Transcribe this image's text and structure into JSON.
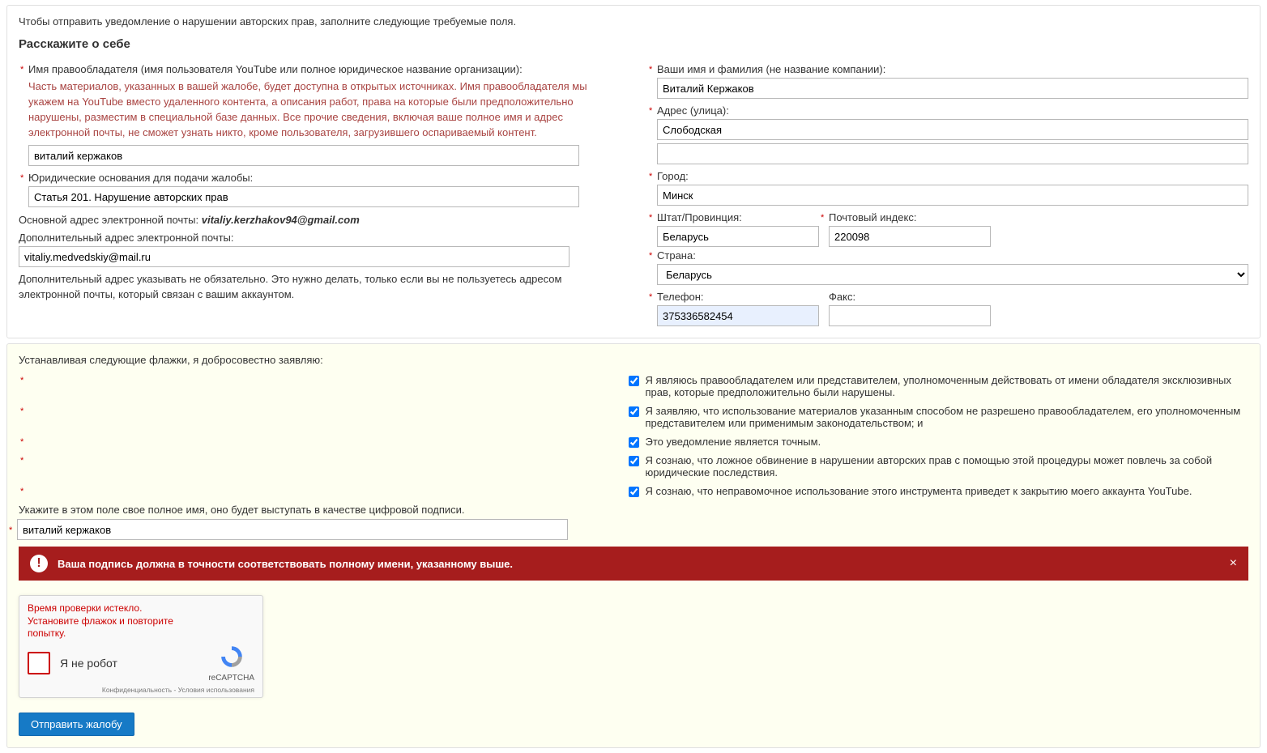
{
  "intro": "Чтобы отправить уведомление о нарушении авторских прав, заполните следующие требуемые поля.",
  "about_heading": "Расскажите о себе",
  "left": {
    "owner_name_label": "Имя правообладателя (имя пользователя YouTube или полное юридическое название организации):",
    "owner_warning": "Часть материалов, указанных в вашей жалобе, будет доступна в открытых источниках. Имя правообладателя мы укажем на YouTube вместо удаленного контента, а описания работ, права на которые были предположительно нарушены, разместим в специальной базе данных. Все прочие сведения, включая ваше полное имя и адрес электронной почты, не сможет узнать никто, кроме пользователя, загрузившего оспариваемый контент.",
    "owner_value": "виталий кержаков",
    "legal_label": "Юридические основания для подачи жалобы:",
    "legal_value": "Статья 201. Нарушение авторских прав",
    "primary_email_label": "Основной адрес электронной почты: ",
    "primary_email_value": "vitaliy.kerzhakov94@gmail.com",
    "alt_email_label": "Дополнительный адрес электронной почты:",
    "alt_email_value": "vitaliy.medvedskiy@mail.ru",
    "alt_help": "Дополнительный адрес указывать не обязательно. Это нужно делать, только если вы не пользуетесь адресом электронной почты, который связан с вашим аккаунтом."
  },
  "right": {
    "fullname_label": "Ваши имя и фамилия (не название компании):",
    "fullname_value": "Виталий Кержаков",
    "street_label": "Адрес (улица):",
    "street_value": "Слободская",
    "street2_value": "",
    "city_label": "Город:",
    "city_value": "Минск",
    "state_label": "Штат/Провинция:",
    "state_value": "Беларусь",
    "zip_label": "Почтовый индекс:",
    "zip_value": "220098",
    "country_label": "Страна:",
    "country_value": "Беларусь",
    "phone_label": "Телефон:",
    "phone_value": "375336582454",
    "fax_label": "Факс:",
    "fax_value": ""
  },
  "decl": {
    "intro": "Устанавливая следующие флажки, я добросовестно заявляю:",
    "c1": "Я являюсь правообладателем или представителем, уполномоченным действовать от имени обладателя эксклюзивных прав, которые предположительно были нарушены.",
    "c2": "Я заявляю, что использование материалов указанным способом не разрешено правообладателем, его уполномоченным представителем или применимым законодательством; и",
    "c3": "Это уведомление является точным.",
    "c4": "Я сознаю, что ложное обвинение в нарушении авторских прав с помощью этой процедуры может повлечь за собой юридические последствия.",
    "c5": "Я сознаю, что неправомочное использование этого инструмента приведет к закрытию моего аккаунта YouTube.",
    "sig_label": "Укажите в этом поле свое полное имя, оно будет выступать в качестве цифровой подписи.",
    "sig_value": "виталий кержаков"
  },
  "alert": "Ваша подпись должна в точности соответствовать полному имени, указанному выше.",
  "recaptcha": {
    "expired": "Время проверки истекло. Установите флажок и повторите попытку.",
    "label": "Я не робот",
    "brand": "reCAPTCHA",
    "links": "Конфиденциальность - Условия использования"
  },
  "submit": "Отправить жалобу"
}
